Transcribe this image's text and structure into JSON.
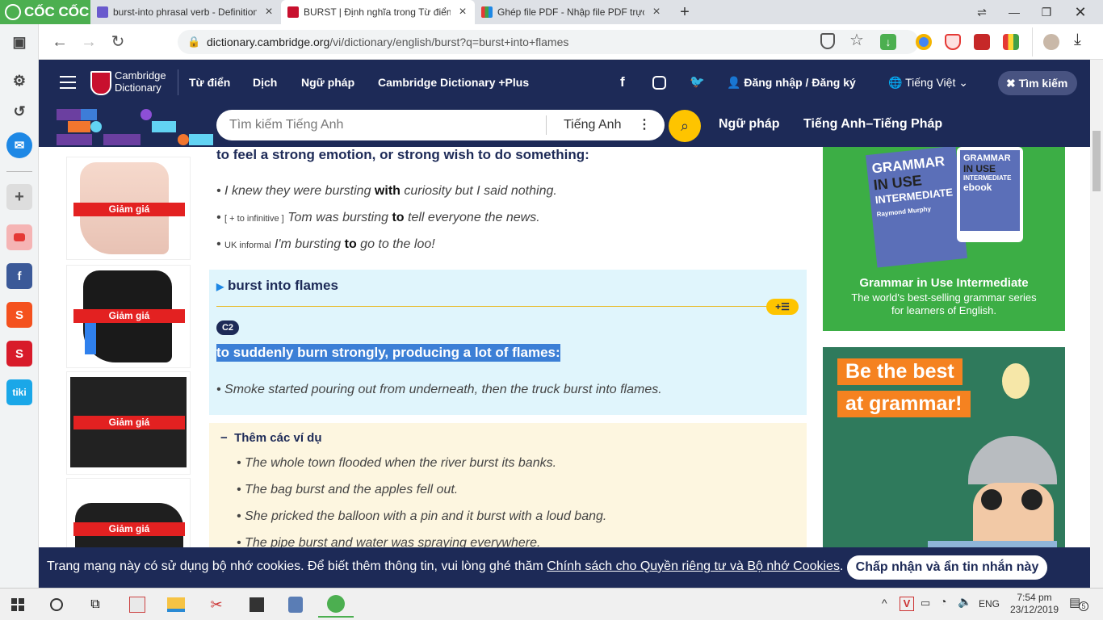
{
  "browser": {
    "brand": "CỐC CỐC",
    "tabs": [
      {
        "title": "burst-into phrasal verb - Definition"
      },
      {
        "title": "BURST | Định nghĩa trong Từ điển"
      },
      {
        "title": "Ghép file PDF - Nhập file PDF trực"
      }
    ],
    "new_tab": "+",
    "url_domain": "dictionary.cambridge.org",
    "url_path": "/vi/dictionary/english/burst?q=burst+into+flames"
  },
  "site": {
    "logo_line1": "Cambridge",
    "logo_line2": "Dictionary",
    "nav": [
      "Từ điển",
      "Dịch",
      "Ngữ pháp",
      "Cambridge Dictionary +Plus"
    ],
    "login": "Đăng nhập / Đăng ký",
    "language": "Tiếng Việt",
    "search_toggle": "Tìm kiếm",
    "search_placeholder": "Tìm kiếm Tiếng Anh",
    "search_dict": "Tiếng Anh",
    "subnav": [
      "Ngữ pháp",
      "Tiếng Anh–Tiếng Pháp"
    ]
  },
  "ads_left": {
    "sale_label": "Giảm giá",
    "colors": {
      "sale": "#e32121"
    }
  },
  "entry": {
    "def_top": "to feel a strong emotion, or strong wish to do something:",
    "examples_top": [
      {
        "label": "",
        "pre": "I knew they were bursting ",
        "bold": "with",
        "post": " curiosity but I said nothing."
      },
      {
        "label": "[ + to infinitive ]",
        "pre": "Tom was bursting ",
        "bold": "to",
        "post": " tell everyone the news."
      },
      {
        "label": "UK informal",
        "pre": "I'm bursting ",
        "bold": "to",
        "post": " go to the loo!"
      }
    ],
    "phrase": "burst into flames",
    "level": "C2",
    "phrase_def": "to suddenly burn strongly, producing a lot of flames:",
    "phrase_example": "Smoke started pouring out from underneath, then the truck burst into flames.",
    "more_title": "Thêm các ví dụ",
    "more_examples": [
      "The whole town flooded when the river burst its banks.",
      "The bag burst and the apples fell out.",
      "She pricked the balloon with a pin and it burst with a loud bang.",
      "The pipe burst and water was spraying everywhere."
    ]
  },
  "ads_right": {
    "book_title": "Grammar in Use Intermediate",
    "book_sub1": "The world's best-selling grammar series",
    "book_sub2": "for learners of English.",
    "cover1_a": "GRAMMAR",
    "cover1_b": "IN USE",
    "cover1_c": "INTERMEDIATE",
    "cover1_d": "Raymond Murphy",
    "cover2_a": "GRAMMAR",
    "cover2_b": "IN USE",
    "cover2_c": "INTERMEDIATE",
    "cover2_d": "ebook",
    "banner_line1": "Be the best",
    "banner_line2": "at grammar!"
  },
  "cookie": {
    "text": "Trang mạng này có sử dụng bộ nhớ cookies. Để biết thêm thông tin, vui lòng ghé thăm ",
    "link": "Chính sách cho Quyền riêng tư và Bộ nhớ Cookies",
    "end": ".",
    "button": "Chấp nhận và ẩn tin nhắn này"
  },
  "taskbar": {
    "lang": "ENG",
    "time": "7:54 pm",
    "date": "23/12/2019",
    "notif": "5"
  }
}
